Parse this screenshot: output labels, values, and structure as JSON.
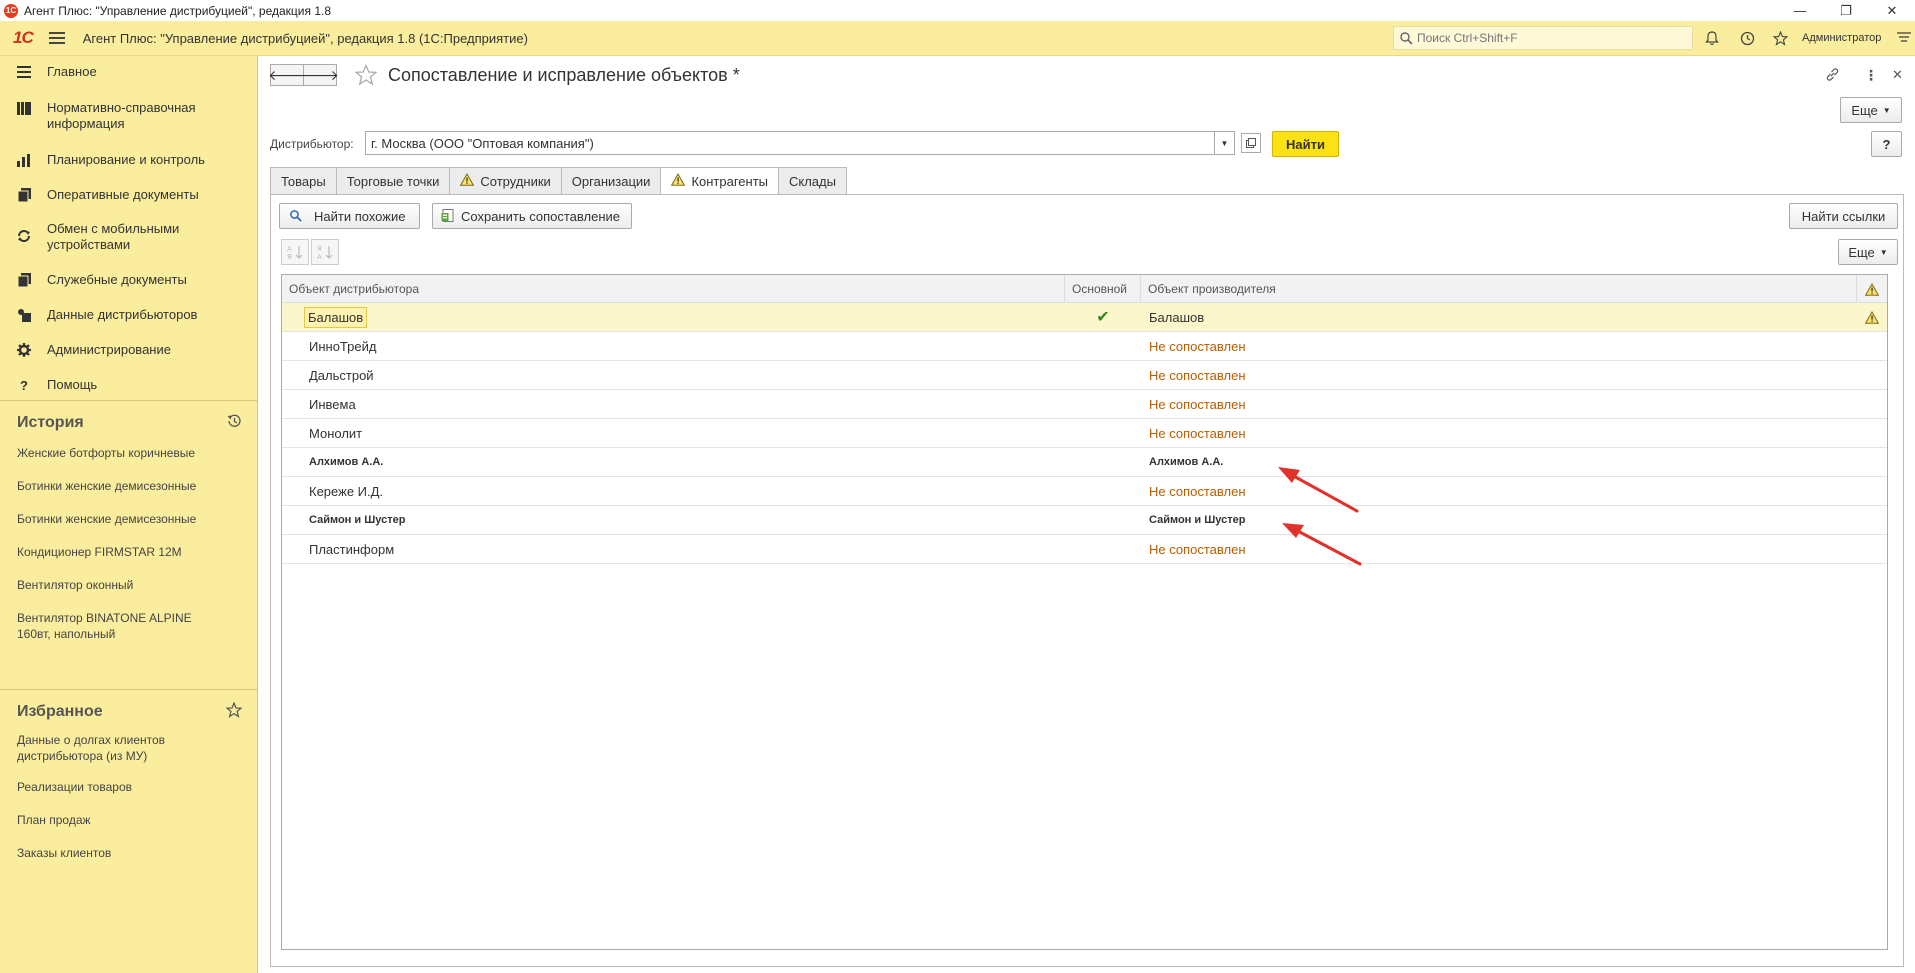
{
  "window": {
    "title": "Агент Плюс: \"Управление дистрибуцией\", редакция 1.8",
    "minimize": "—",
    "restore": "❐",
    "close": "✕"
  },
  "header": {
    "logo": "1С",
    "app_title": "Агент Плюс: \"Управление дистрибуцией\", редакция 1.8  (1С:Предприятие)",
    "search_placeholder": "Поиск Ctrl+Shift+F",
    "user": "Администратор"
  },
  "sidebar": {
    "nav": [
      {
        "label": "Главное",
        "icon": "menu-icon"
      },
      {
        "label": "Нормативно-справочная информация",
        "icon": "catalog-icon"
      },
      {
        "label": "Планирование и контроль",
        "icon": "chart-icon"
      },
      {
        "label": "Оперативные документы",
        "icon": "documents-icon"
      },
      {
        "label": "Обмен с мобильными устройствами",
        "icon": "sync-icon"
      },
      {
        "label": "Служебные документы",
        "icon": "service-docs-icon"
      },
      {
        "label": "Данные дистрибьюторов",
        "icon": "distributors-icon"
      },
      {
        "label": "Администрирование",
        "icon": "gear-icon"
      },
      {
        "label": "Помощь",
        "icon": "help-icon"
      }
    ],
    "history": {
      "title": "История",
      "items": [
        "Женские ботфорты коричневые",
        "Ботинки женские демисезонные",
        "Ботинки женские демисезонные",
        "Кондиционер FIRMSTAR 12M",
        "Вентилятор оконный",
        "Вентилятор BINATONE ALPINE 160вт, напольный"
      ]
    },
    "favorites": {
      "title": "Избранное",
      "items": [
        "Данные о долгах клиентов дистрибьютора (из МУ)",
        "Реализации товаров",
        "План продаж",
        "Заказы клиентов"
      ]
    }
  },
  "form": {
    "back": "🡐",
    "forward": "🡒",
    "title": "Сопоставление и исправление объектов *",
    "more_button": "Еще",
    "help_button": "?",
    "distributor_label": "Дистрибьютор:",
    "distributor_value": "г. Москва  (ООО \"Оптовая компания\")",
    "find_button": "Найти",
    "tabs": [
      {
        "label": "Товары",
        "warn": false,
        "active": false
      },
      {
        "label": "Торговые точки",
        "warn": false,
        "active": false
      },
      {
        "label": "Сотрудники",
        "warn": true,
        "active": false
      },
      {
        "label": "Организации",
        "warn": false,
        "active": false
      },
      {
        "label": "Контрагенты",
        "warn": true,
        "active": true
      },
      {
        "label": "Склады",
        "warn": false,
        "active": false
      }
    ],
    "find_similar_button": "Найти похожие",
    "save_mapping_button": "Сохранить сопоставление",
    "find_links_button": "Найти ссылки",
    "more_button_2": "Еще",
    "columns": {
      "distributor_object": "Объект дистрибьютора",
      "main": "Основной",
      "producer_object": "Объект производителя"
    },
    "rows": [
      {
        "distributor": "Балашов",
        "main": "✔",
        "producer": "Балашов",
        "status": "matched",
        "selected": true,
        "bold": false,
        "warn": true
      },
      {
        "distributor": "ИнноТрейд",
        "main": "",
        "producer": "Не сопоставлен",
        "status": "unmatched",
        "selected": false,
        "bold": false,
        "warn": false
      },
      {
        "distributor": "Дальстрой",
        "main": "",
        "producer": "Не сопоставлен",
        "status": "unmatched",
        "selected": false,
        "bold": false,
        "warn": false
      },
      {
        "distributor": "Инвема",
        "main": "",
        "producer": "Не сопоставлен",
        "status": "unmatched",
        "selected": false,
        "bold": false,
        "warn": false
      },
      {
        "distributor": "Монолит",
        "main": "",
        "producer": "Не сопоставлен",
        "status": "unmatched",
        "selected": false,
        "bold": false,
        "warn": false
      },
      {
        "distributor": "Алхимов А.А.",
        "main": "",
        "producer": "Алхимов А.А.",
        "status": "matched",
        "selected": false,
        "bold": true,
        "warn": false
      },
      {
        "distributor": "Кереже И.Д.",
        "main": "",
        "producer": "Не сопоставлен",
        "status": "unmatched",
        "selected": false,
        "bold": false,
        "warn": false
      },
      {
        "distributor": "Саймон и Шустер",
        "main": "",
        "producer": "Саймон и Шустер",
        "status": "matched",
        "selected": false,
        "bold": true,
        "warn": false
      },
      {
        "distributor": "Пластинформ",
        "main": "",
        "producer": "Не сопоставлен",
        "status": "unmatched",
        "selected": false,
        "bold": false,
        "warn": false
      }
    ]
  },
  "colors": {
    "sidebar_bg": "#fbed9e",
    "accent_button": "#fce114",
    "unmatched_text": "#b85c00",
    "arrow": "#e0312b",
    "check": "#2e8b1e"
  }
}
